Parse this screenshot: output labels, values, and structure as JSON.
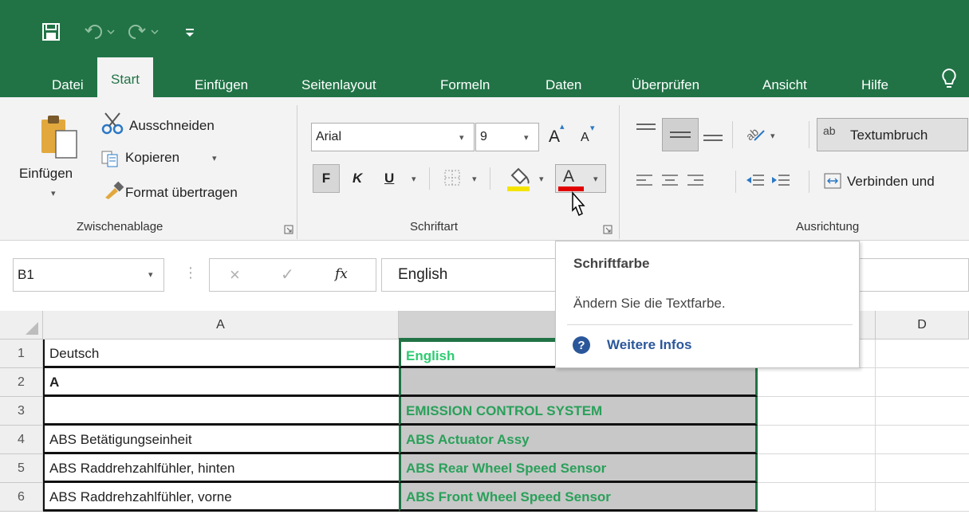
{
  "ribbon_tabs": [
    "Datei",
    "Start",
    "Einfügen",
    "Seitenlayout",
    "Formeln",
    "Daten",
    "Überprüfen",
    "Ansicht",
    "Hilfe"
  ],
  "clipboard": {
    "paste": "Einfügen",
    "cut": "Ausschneiden",
    "copy": "Kopieren",
    "format_painter": "Format übertragen",
    "group_label": "Zwischenablage"
  },
  "font": {
    "name": "Arial",
    "size": "9",
    "bold": "F",
    "italic": "K",
    "underline": "U",
    "grow": "A",
    "shrink": "A",
    "font_color_glyph": "A",
    "group_label": "Schriftart"
  },
  "alignment": {
    "wrap_text": "Textumbruch",
    "merge": "Verbinden und",
    "group_label": "Ausrichtung"
  },
  "formula_bar": {
    "name_box": "B1",
    "fx": "fx",
    "value": "English"
  },
  "tooltip": {
    "title": "Schriftfarbe",
    "description": "Ändern Sie die Textfarbe.",
    "link": "Weitere Infos"
  },
  "columns": [
    "A",
    "D"
  ],
  "rows": [
    {
      "num": "1",
      "a": "Deutsch",
      "b": "English"
    },
    {
      "num": "2",
      "a": "A",
      "b": ""
    },
    {
      "num": "3",
      "a": "",
      "b": "EMISSION CONTROL SYSTEM"
    },
    {
      "num": "4",
      "a": "ABS Betätigungseinheit",
      "b": "ABS Actuator Assy"
    },
    {
      "num": "5",
      "a": "ABS Raddrehzahlfühler, hinten",
      "b": "ABS Rear Wheel Speed Sensor"
    },
    {
      "num": "6",
      "a": "ABS Raddrehzahlfühler, vorne",
      "b": "ABS Front Wheel Speed Sensor"
    }
  ],
  "colors": {
    "excel_green": "#217346",
    "font_color_red": "#e00000",
    "fill_yellow": "#f5e400",
    "cell_text_green": "#2aa05a"
  }
}
